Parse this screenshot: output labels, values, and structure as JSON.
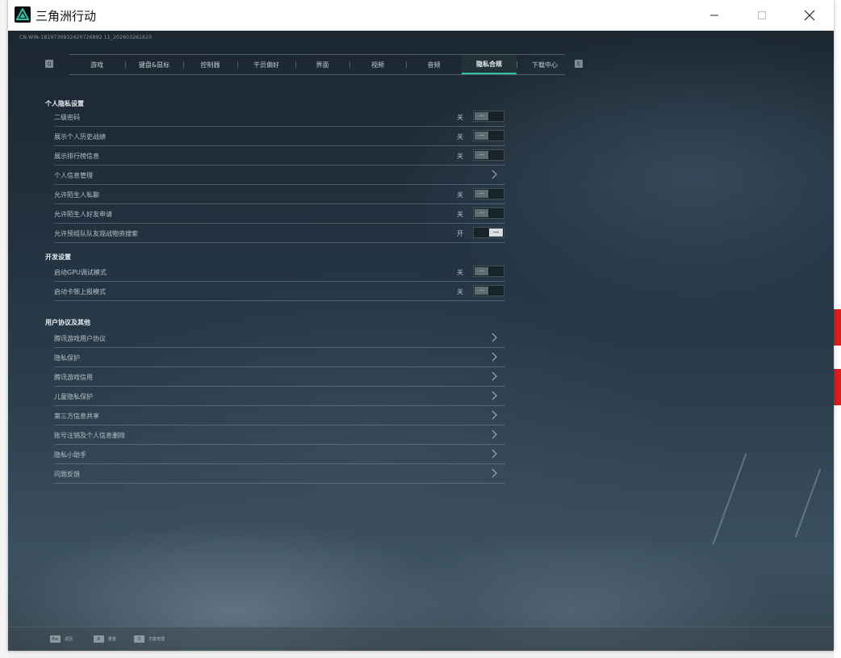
{
  "window": {
    "title": "三角洲行动"
  },
  "build_id": "CN-WIN-1819730932420726892 11_202603261620",
  "tabs": [
    {
      "label": "游戏",
      "width": 70
    },
    {
      "label": "键盘&鼠标",
      "width": 72
    },
    {
      "label": "控制器",
      "width": 67
    },
    {
      "label": "干员偏好",
      "width": 72
    },
    {
      "label": "界面",
      "width": 67
    },
    {
      "label": "视频",
      "width": 70
    },
    {
      "label": "音频",
      "width": 69
    },
    {
      "label": "隐私合规",
      "width": 68,
      "active": true
    },
    {
      "label": "下载中心",
      "width": 70
    }
  ],
  "tab_keys": {
    "left": "Q",
    "right": "E"
  },
  "sections": {
    "privacy": {
      "title": "个人隐私设置",
      "rows": [
        {
          "label": "二级密码",
          "state": "关",
          "kind": "toggle",
          "on": false
        },
        {
          "label": "展示个人历史战绩",
          "state": "关",
          "kind": "toggle",
          "on": false
        },
        {
          "label": "展示排行榜信息",
          "state": "关",
          "kind": "toggle",
          "on": false
        },
        {
          "label": "个人信息管理",
          "kind": "link"
        },
        {
          "label": "允许陌生人私聊",
          "state": "关",
          "kind": "toggle",
          "on": false
        },
        {
          "label": "允许陌生人好友申请",
          "state": "关",
          "kind": "toggle",
          "on": false
        },
        {
          "label": "允许预组队队友观战物资搜索",
          "state": "开",
          "kind": "toggle",
          "on": true
        }
      ]
    },
    "developer": {
      "title": "开发设置",
      "rows": [
        {
          "label": "启动GPU调试模式",
          "state": "关",
          "kind": "toggle",
          "on": false
        },
        {
          "label": "启动卡顿上报模式",
          "state": "关",
          "kind": "toggle",
          "on": false
        }
      ]
    },
    "agreements": {
      "title": "用户协议及其他",
      "rows": [
        {
          "label": "腾讯游戏用户协议",
          "kind": "link"
        },
        {
          "label": "隐私保护",
          "kind": "link"
        },
        {
          "label": "腾讯游戏信用",
          "kind": "link"
        },
        {
          "label": "儿童隐私保护",
          "kind": "link"
        },
        {
          "label": "第三方信息共享",
          "kind": "link"
        },
        {
          "label": "账号注销及个人信息删除",
          "kind": "link"
        },
        {
          "label": "隐私小助手",
          "kind": "link"
        },
        {
          "label": "问题反馈",
          "kind": "link"
        }
      ]
    }
  },
  "footer": [
    {
      "key": "Esc",
      "label": "返回"
    },
    {
      "key": "R",
      "label": "重置"
    },
    {
      "key": "S",
      "label": "方案管理"
    }
  ],
  "colors": {
    "accent": "#33c2a0",
    "panel_bg": "#223240"
  }
}
